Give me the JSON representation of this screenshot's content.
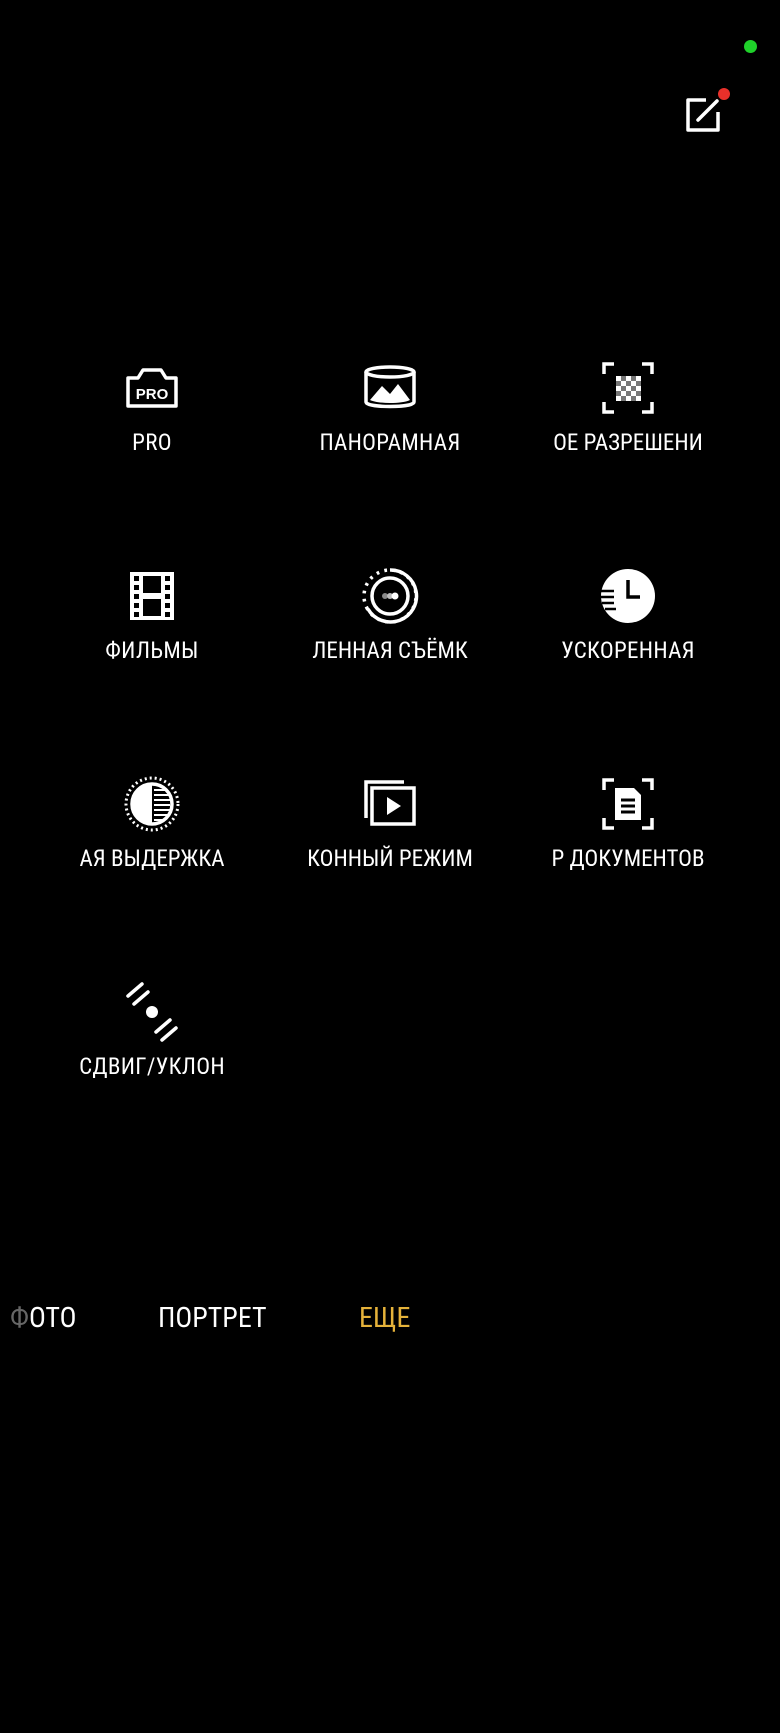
{
  "modes": [
    {
      "id": "pro",
      "label": "PRO",
      "icon": "camera-pro-icon",
      "icon_text": "PRO"
    },
    {
      "id": "panorama",
      "label": "ПАНОРАМНАЯ",
      "icon": "panorama-icon"
    },
    {
      "id": "hires",
      "label": "ОЕ РАЗРЕШЕНИ",
      "icon": "high-resolution-icon"
    },
    {
      "id": "movies",
      "label": "ФИЛЬМЫ",
      "icon": "film-icon"
    },
    {
      "id": "slowmo",
      "label": "ЛЕННАЯ СЪЁМК",
      "icon": "slow-motion-icon"
    },
    {
      "id": "timelapse",
      "label": "УСКОРЕННАЯ",
      "icon": "timelapse-icon"
    },
    {
      "id": "longexp",
      "label": "АЯ ВЫДЕРЖКА",
      "icon": "long-exposure-icon"
    },
    {
      "id": "cinematic",
      "label": "КОННЫЙ РЕЖИМ",
      "icon": "video-play-icon"
    },
    {
      "id": "docscan",
      "label": "Р ДОКУМЕНТОВ",
      "icon": "document-scan-icon"
    },
    {
      "id": "tiltshift",
      "label": "СДВИГ/УКЛОН",
      "icon": "tilt-shift-icon"
    }
  ],
  "tabs": {
    "foto_fade": "Ф",
    "foto": "ОТО",
    "portrait": "ПОРТРЕТ",
    "more": "ЕЩЕ"
  },
  "colors": {
    "status_dot": "#1fd12a",
    "notification_dot": "#e8302a",
    "active_tab": "#e5b23a"
  }
}
